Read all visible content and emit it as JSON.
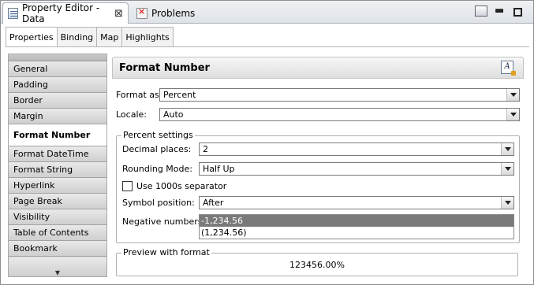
{
  "viewbar": {
    "active_tab": "Property Editor - Data",
    "other_tab": "Problems"
  },
  "subtabs": [
    "Properties",
    "Binding",
    "Map",
    "Highlights"
  ],
  "categories": [
    "General",
    "Padding",
    "Border",
    "Margin",
    "Format Number",
    "Format DateTime",
    "Format String",
    "Hyperlink",
    "Page Break",
    "Visibility",
    "Table of Contents",
    "Bookmark"
  ],
  "selected_category": "Format Number",
  "section": {
    "title": "Format Number"
  },
  "format_as": {
    "label": "Format as:",
    "value": "Percent"
  },
  "locale": {
    "label": "Locale:",
    "value": "Auto"
  },
  "percent_settings": {
    "legend": "Percent settings",
    "decimal_places": {
      "label": "Decimal places:",
      "value": "2"
    },
    "rounding_mode": {
      "label": "Rounding Mode:",
      "value": "Half Up"
    },
    "use_1000s": {
      "label": "Use 1000s separator",
      "checked": false
    },
    "symbol_position": {
      "label": "Symbol position:",
      "value": "After"
    },
    "negative_numbers": {
      "label": "Negative numbers:",
      "options": [
        "-1,234.56",
        "(1,234.56)"
      ],
      "selected_index": 0
    }
  },
  "preview": {
    "legend": "Preview with format",
    "value": "123456.00%"
  },
  "colors": {
    "selection": "#7a7a7a",
    "tab_bar": "#dfe3e8"
  }
}
